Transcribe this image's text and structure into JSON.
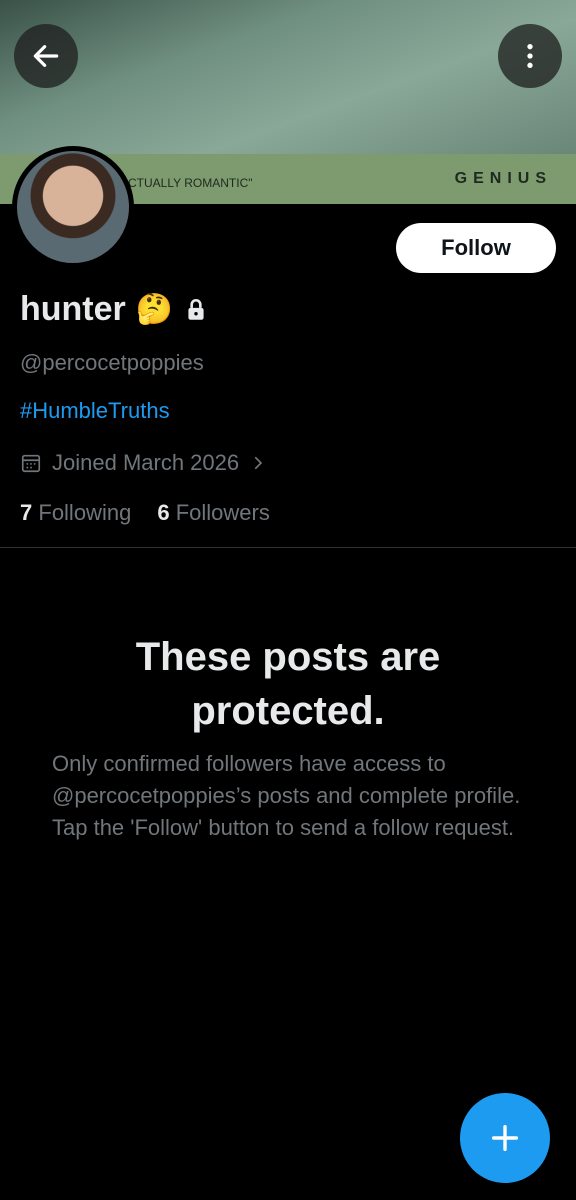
{
  "banner": {
    "brand_text": "GENIUS",
    "strip_text": "CTUALLY ROMANTIC\""
  },
  "header": {
    "back_icon": "arrow-left-icon",
    "more_icon": "more-vertical-icon"
  },
  "profile": {
    "name": "hunter",
    "emoji": "🤔",
    "lock_icon": "lock-icon",
    "handle": "@percocetpoppies",
    "hashtag": "#HumbleTruths",
    "joined": "Joined March 2026",
    "following_count": "7",
    "following_label": "Following",
    "followers_count": "6",
    "followers_label": "Followers",
    "follow_button": "Follow"
  },
  "protected": {
    "title": "These posts are protected.",
    "body": "Only confirmed followers have access to @percocetpoppies’s posts and complete profile. Tap the 'Follow' button to send a follow request."
  },
  "colors": {
    "accent": "#1d9bf0",
    "background": "#000000",
    "muted": "#71767b"
  }
}
